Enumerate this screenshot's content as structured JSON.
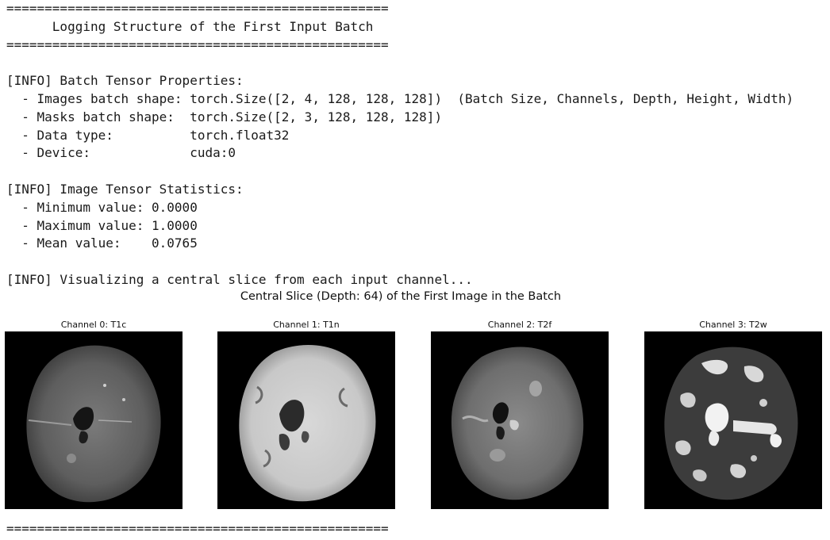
{
  "log_lines": [
    "==================================================",
    "      Logging Structure of the First Input Batch",
    "==================================================",
    "",
    "[INFO] Batch Tensor Properties:",
    "  - Images batch shape: torch.Size([2, 4, 128, 128, 128])  (Batch Size, Channels, Depth, Height, Width)",
    "  - Masks batch shape:  torch.Size([2, 3, 128, 128, 128])",
    "  - Data type:          torch.float32",
    "  - Device:             cuda:0",
    "",
    "[INFO] Image Tensor Statistics:",
    "  - Minimum value: 0.0000",
    "  - Maximum value: 1.0000",
    "  - Mean value:    0.0765",
    "",
    "[INFO] Visualizing a central slice from each input channel..."
  ],
  "figure": {
    "title": "Central Slice (Depth: 64) of the First Image in the Batch",
    "panels": [
      {
        "title": "Channel 0: T1c",
        "style": "t1c"
      },
      {
        "title": "Channel 1: T1n",
        "style": "t1n"
      },
      {
        "title": "Channel 2: T2f",
        "style": "t2f"
      },
      {
        "title": "Channel 3: T2w",
        "style": "t2w"
      }
    ]
  },
  "bottom_rule": "=================================================="
}
